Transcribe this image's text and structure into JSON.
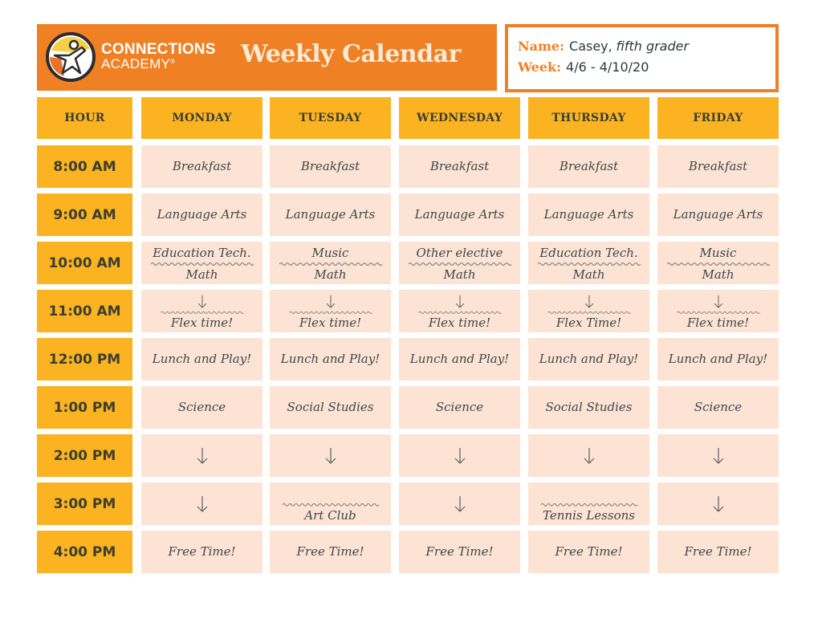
{
  "header": {
    "brand_line1": "CONNECTIONS",
    "brand_line2": "ACADEMY",
    "brand_reg": "®",
    "title": "Weekly Calendar"
  },
  "info": {
    "name_label": "Name:",
    "name_value": "Casey,",
    "name_note": "fifth grader",
    "week_label": "Week:",
    "week_value": "4/6 - 4/10/20"
  },
  "colors": {
    "banner": "#f08024",
    "header_cell": "#fbb321",
    "slot_cell": "#fce3d3",
    "text_dark": "#3a3f31"
  },
  "columns": [
    "HOUR",
    "MONDAY",
    "TUESDAY",
    "WEDNESDAY",
    "THURSDAY",
    "FRIDAY"
  ],
  "hours": [
    "8:00 AM",
    "9:00 AM",
    "10:00 AM",
    "11:00 AM",
    "12:00 PM",
    "1:00 PM",
    "2:00 PM",
    "3:00 PM",
    "4:00 PM"
  ],
  "schedule": [
    [
      {
        "top": "Breakfast"
      },
      {
        "top": "Breakfast"
      },
      {
        "top": "Breakfast"
      },
      {
        "top": "Breakfast"
      },
      {
        "top": "Breakfast"
      }
    ],
    [
      {
        "top": "Language Arts"
      },
      {
        "top": "Language Arts"
      },
      {
        "top": "Language Arts"
      },
      {
        "top": "Language Arts"
      },
      {
        "top": "Language Arts"
      }
    ],
    [
      {
        "top": "Education Tech.",
        "divider": true,
        "bottom": "Math"
      },
      {
        "top": "Music",
        "divider": true,
        "bottom": "Math"
      },
      {
        "top": "Other elective",
        "divider": true,
        "bottom": "Math"
      },
      {
        "top": "Education Tech.",
        "divider": true,
        "bottom": "Math"
      },
      {
        "top": "Music",
        "divider": true,
        "bottom": "Math"
      }
    ],
    [
      {
        "arrow": true,
        "divider": true,
        "bottom": "Flex time!"
      },
      {
        "arrow": true,
        "divider": true,
        "bottom": "Flex time!"
      },
      {
        "arrow": true,
        "divider": true,
        "bottom": "Flex time!"
      },
      {
        "arrow": true,
        "divider": true,
        "bottom": "Flex Time!"
      },
      {
        "arrow": true,
        "divider": true,
        "bottom": "Flex time!"
      }
    ],
    [
      {
        "top": "Lunch and Play!"
      },
      {
        "top": "Lunch and Play!"
      },
      {
        "top": "Lunch and Play!"
      },
      {
        "top": "Lunch and Play!"
      },
      {
        "top": "Lunch and Play!"
      }
    ],
    [
      {
        "top": "Science"
      },
      {
        "top": "Social Studies"
      },
      {
        "top": "Science"
      },
      {
        "top": "Social Studies"
      },
      {
        "top": "Science"
      }
    ],
    [
      {
        "arrow": true
      },
      {
        "arrow": true
      },
      {
        "arrow": true
      },
      {
        "arrow": true
      },
      {
        "arrow": true
      }
    ],
    [
      {
        "arrow": true
      },
      {
        "divider": true,
        "bottom": "Art Club"
      },
      {
        "arrow": true
      },
      {
        "divider": true,
        "bottom": "Tennis Lessons"
      },
      {
        "arrow": true
      }
    ],
    [
      {
        "top": "Free Time!"
      },
      {
        "top": "Free Time!"
      },
      {
        "top": "Free Time!"
      },
      {
        "top": "Free Time!"
      },
      {
        "top": "Free Time!"
      }
    ]
  ]
}
